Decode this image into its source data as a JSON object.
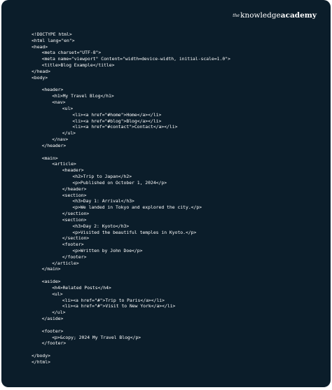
{
  "brand": {
    "the": "the",
    "knowledge": "knowledge",
    "academy": "academy"
  },
  "code_lines": [
    {
      "indent": 0,
      "text": "<!DOCTYPE html>"
    },
    {
      "indent": 0,
      "text": "<html lang=\"en\">"
    },
    {
      "indent": 0,
      "text": "<head>"
    },
    {
      "indent": 1,
      "text": "<meta charset=\"UTF-8\">"
    },
    {
      "indent": 1,
      "text": "<meta name=\"viewport\" Content=\"width=device-width, initial-scale=1.0\">"
    },
    {
      "indent": 1,
      "text": "<title>Blog Example</title>"
    },
    {
      "indent": 0,
      "text": "</head>"
    },
    {
      "indent": 0,
      "text": "<body>"
    },
    {
      "indent": 0,
      "text": ""
    },
    {
      "indent": 1,
      "text": "<header>"
    },
    {
      "indent": 2,
      "text": "<h1>My Travel Blog</h1>"
    },
    {
      "indent": 2,
      "text": "<nav>"
    },
    {
      "indent": 3,
      "text": "<ul>"
    },
    {
      "indent": 4,
      "text": "<li><a href=\"#home\">Home</a></li>"
    },
    {
      "indent": 4,
      "text": "<li><a href=\"#blog\">Blog</a></li>"
    },
    {
      "indent": 4,
      "text": "<li><a href=\"#contact\">Contact</a></li>"
    },
    {
      "indent": 3,
      "text": "</ul>"
    },
    {
      "indent": 2,
      "text": "</nav>"
    },
    {
      "indent": 1,
      "text": "</header>"
    },
    {
      "indent": 0,
      "text": ""
    },
    {
      "indent": 1,
      "text": "<main>"
    },
    {
      "indent": 2,
      "text": "<article>"
    },
    {
      "indent": 3,
      "text": "<header>"
    },
    {
      "indent": 4,
      "text": "<h2>Trip to Japan</h2>"
    },
    {
      "indent": 4,
      "text": "<p>Published on October 1, 2024</p>"
    },
    {
      "indent": 3,
      "text": "</header>"
    },
    {
      "indent": 3,
      "text": "<section>"
    },
    {
      "indent": 4,
      "text": "<h3>Day 1: Arrival</h3>"
    },
    {
      "indent": 4,
      "text": "<p>We landed in Tokyo and explored the city.</p>"
    },
    {
      "indent": 3,
      "text": "</section>"
    },
    {
      "indent": 3,
      "text": "<section>"
    },
    {
      "indent": 4,
      "text": "<h3>Day 2: Kyoto</h3>"
    },
    {
      "indent": 4,
      "text": "<p>Visited the beautiful temples in Kyoto.</p>"
    },
    {
      "indent": 3,
      "text": "</section>"
    },
    {
      "indent": 3,
      "text": "<footer>"
    },
    {
      "indent": 4,
      "text": "<p>Written by John Doe</p>"
    },
    {
      "indent": 3,
      "text": "</footer>"
    },
    {
      "indent": 2,
      "text": "</article>"
    },
    {
      "indent": 1,
      "text": "</main>"
    },
    {
      "indent": 0,
      "text": ""
    },
    {
      "indent": 1,
      "text": "<aside>"
    },
    {
      "indent": 2,
      "text": "<h4>Related Posts</h4>"
    },
    {
      "indent": 2,
      "text": "<ul>"
    },
    {
      "indent": 3,
      "text": "<li><a href=\"#\">Trip to Paris</a></li>"
    },
    {
      "indent": 3,
      "text": "<li><a href=\"#\">Visit to New York</a></li>"
    },
    {
      "indent": 2,
      "text": "</ul>"
    },
    {
      "indent": 1,
      "text": "</aside>"
    },
    {
      "indent": 0,
      "text": ""
    },
    {
      "indent": 1,
      "text": "<footer>"
    },
    {
      "indent": 2,
      "text": "<p>&copy; 2024 My Travel Blog</p>"
    },
    {
      "indent": 1,
      "text": "</footer>"
    },
    {
      "indent": 0,
      "text": ""
    },
    {
      "indent": 0,
      "text": "</body>"
    },
    {
      "indent": 0,
      "text": "</html>"
    }
  ],
  "colors": {
    "background": "#0b1d2a",
    "text": "#ffffff"
  }
}
